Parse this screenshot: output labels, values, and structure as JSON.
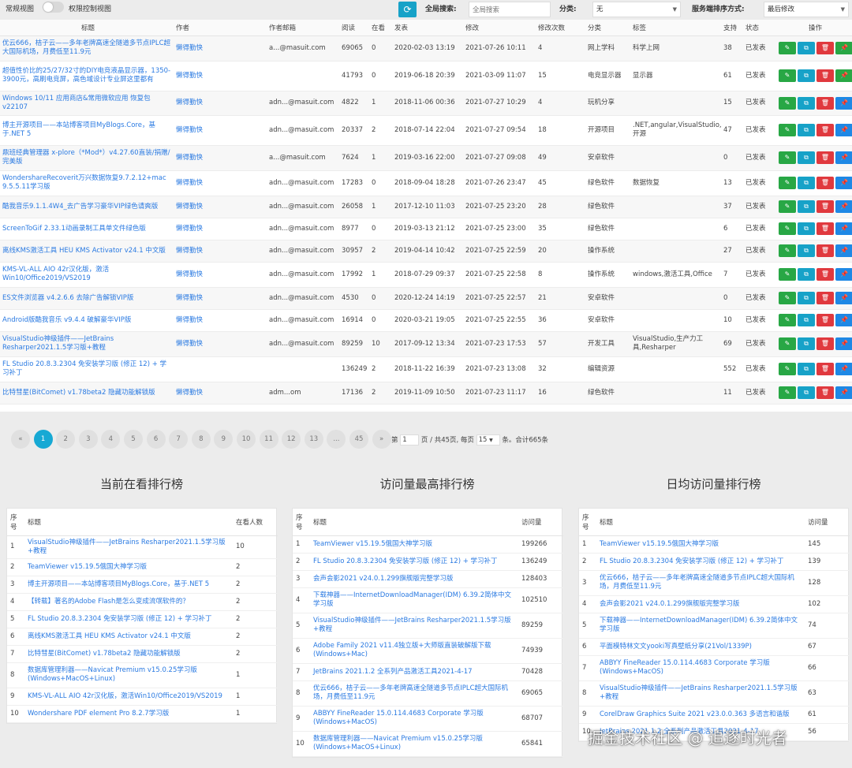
{
  "topbar": {
    "view_label": "常规视图",
    "perm_label": "权限控制视图",
    "search_label": "全局搜索:",
    "search_placeholder": "全局搜索",
    "category_label": "分类:",
    "category_value": "无",
    "sort_label": "服务端排序方式:",
    "sort_value": "最后修改"
  },
  "table": {
    "headers": [
      "标题",
      "作者",
      "作者邮箱",
      "阅读",
      "在看",
      "发表",
      "修改",
      "修改次数",
      "分类",
      "标签",
      "支持",
      "状态",
      "操作"
    ],
    "rows": [
      {
        "title": "优云666，桔子云——多年老牌高速全隧道多节点IPLC超大国际机场，月费低至11.9元",
        "author": "懒得勤快",
        "email": "a...@masuit.com",
        "read": "69065",
        "watch": "0",
        "created": "2020-02-03 13:19",
        "modified": "2021-07-26 10:11",
        "mods": "4",
        "cat": "网上学科",
        "tags": "科学上网",
        "support": "38",
        "status": "已发表"
      },
      {
        "title": "超值性价比的25/27/32寸的DIY电竞液晶显示器，1350-3900元，高刷电竞屏，高色域设计专业屏这里都有",
        "author": "懒得勤快",
        "email": "",
        "read": "41793",
        "watch": "0",
        "created": "2019-06-18 20:39",
        "modified": "2021-03-09 11:07",
        "mods": "15",
        "cat": "电竞显示器",
        "tags": "显示器",
        "support": "61",
        "status": "已发表"
      },
      {
        "title": "Windows 10/11 应用商店&常用微软应用 恢复包v22107",
        "author": "懒得勤快",
        "email": "adn...@masuit.com",
        "read": "4822",
        "watch": "1",
        "created": "2018-11-06 00:36",
        "modified": "2021-07-27 10:29",
        "mods": "4",
        "cat": "玩机分享",
        "tags": "",
        "support": "15",
        "status": "已发表"
      },
      {
        "title": "博主开源项目——本站博客项目MyBlogs.Core，基于.NET 5",
        "author": "懒得勤快",
        "email": "adn...@masuit.com",
        "read": "20337",
        "watch": "2",
        "created": "2018-07-14 22:04",
        "modified": "2021-07-27 09:54",
        "mods": "18",
        "cat": "开源项目",
        "tags": ".NET,angular,VisualStudio,开源",
        "support": "47",
        "status": "已发表"
      },
      {
        "title": "鼎班经典管理器 x-plore（*Mod*）v4.27.60直装/捐赠/完美版",
        "author": "懒得勤快",
        "email": "a...@masuit.com",
        "read": "7624",
        "watch": "1",
        "created": "2019-03-16 22:00",
        "modified": "2021-07-27 09:08",
        "mods": "49",
        "cat": "安卓软件",
        "tags": "",
        "support": "0",
        "status": "已发表"
      },
      {
        "title": "WondershareRecoverit万兴数据恢复9.7.2.12+mac 9.5.5.11学习版",
        "author": "懒得勤快",
        "email": "adn...@masuit.com",
        "read": "17283",
        "watch": "0",
        "created": "2018-09-04 18:28",
        "modified": "2021-07-26 23:47",
        "mods": "45",
        "cat": "绿色软件",
        "tags": "数据恢复",
        "support": "13",
        "status": "已发表"
      },
      {
        "title": "酷我音乐9.1.1.4W4_去广告学习豪华VIP绿色请爽版",
        "author": "懒得勤快",
        "email": "adn...@masuit.com",
        "read": "26058",
        "watch": "1",
        "created": "2017-12-10 11:03",
        "modified": "2021-07-25 23:20",
        "mods": "28",
        "cat": "绿色软件",
        "tags": "",
        "support": "37",
        "status": "已发表"
      },
      {
        "title": "ScreenToGif 2.33.1动画录制工具单文件绿色版",
        "author": "懒得勤快",
        "email": "adn...@masuit.com",
        "read": "8977",
        "watch": "0",
        "created": "2019-03-13 21:12",
        "modified": "2021-07-25 23:00",
        "mods": "35",
        "cat": "绿色软件",
        "tags": "",
        "support": "6",
        "status": "已发表"
      },
      {
        "title": "离线KMS激活工具 HEU KMS Activator v24.1 中文版",
        "author": "懒得勤快",
        "email": "adn...@masuit.com",
        "read": "30957",
        "watch": "2",
        "created": "2019-04-14 10:42",
        "modified": "2021-07-25 22:59",
        "mods": "20",
        "cat": "操作系统",
        "tags": "",
        "support": "27",
        "status": "已发表"
      },
      {
        "title": "KMS-VL-ALL AIO 42r汉化版，激活Win10/Office2019/VS2019",
        "author": "懒得勤快",
        "email": "adn...@masuit.com",
        "read": "17992",
        "watch": "1",
        "created": "2018-07-29 09:37",
        "modified": "2021-07-25 22:58",
        "mods": "8",
        "cat": "操作系统",
        "tags": "windows,激活工具,Office",
        "support": "7",
        "status": "已发表"
      },
      {
        "title": "ES文件浏览器 v4.2.6.6 去除广告解锁VIP版",
        "author": "懒得勤快",
        "email": "adn...@masuit.com",
        "read": "4530",
        "watch": "0",
        "created": "2020-12-24 14:19",
        "modified": "2021-07-25 22:57",
        "mods": "21",
        "cat": "安卓软件",
        "tags": "",
        "support": "0",
        "status": "已发表"
      },
      {
        "title": "Android版酷我音乐 v9.4.4 破解豪华VIP版",
        "author": "懒得勤快",
        "email": "adn...@masuit.com",
        "read": "16914",
        "watch": "0",
        "created": "2020-03-21 19:05",
        "modified": "2021-07-25 22:55",
        "mods": "36",
        "cat": "安卓软件",
        "tags": "",
        "support": "10",
        "status": "已发表"
      },
      {
        "title": "VisualStudio神级插件——JetBrains Resharper2021.1.5学习版+教程",
        "author": "懒得勤快",
        "email": "adn...@masuit.com",
        "read": "89259",
        "watch": "10",
        "created": "2017-09-12 13:34",
        "modified": "2021-07-23 17:53",
        "mods": "57",
        "cat": "开发工具",
        "tags": "VisualStudio,生产力工具,Resharper",
        "support": "69",
        "status": "已发表"
      },
      {
        "title": "FL Studio 20.8.3.2304 免安装学习版 (修正 12) + 学习补丁",
        "author": "",
        "email": "",
        "read": "136249",
        "watch": "2",
        "created": "2018-11-22 16:39",
        "modified": "2021-07-23 13:08",
        "mods": "32",
        "cat": "编辑资源",
        "tags": "",
        "support": "552",
        "status": "已发表"
      },
      {
        "title": "比特彗星(BitComet) v1.78beta2 隐藏功能解锁版",
        "author": "懒得勤快",
        "email": "adm...om",
        "read": "17136",
        "watch": "2",
        "created": "2019-11-09 10:50",
        "modified": "2021-07-23 11:17",
        "mods": "16",
        "cat": "绿色软件",
        "tags": "",
        "support": "11",
        "status": "已发表"
      }
    ]
  },
  "pager": {
    "pages": [
      "«",
      "1",
      "2",
      "3",
      "4",
      "5",
      "6",
      "7",
      "8",
      "9",
      "10",
      "11",
      "12",
      "13",
      "...",
      "45",
      "»"
    ],
    "info_prefix": "第",
    "page_value": "1",
    "info_mid": "页 / 共45页, 每页",
    "per_page": "15",
    "info_suffix": "条。合计665条"
  },
  "panels": [
    {
      "title": "当前在看排行榜",
      "headers": [
        "序号",
        "标题",
        "在看人数"
      ],
      "rows": [
        [
          "1",
          "VisualStudio神级插件——JetBrains Resharper2021.1.5学习版+教程",
          "10"
        ],
        [
          "2",
          "TeamViewer v15.19.5俄国大神学习版",
          "2"
        ],
        [
          "3",
          "博主开源项目——本站博客项目MyBlogs.Core，基于.NET 5",
          "2"
        ],
        [
          "4",
          "【转载】著名的Adobe Flash是怎么变成流氓软件的？",
          "2"
        ],
        [
          "5",
          "FL Studio 20.8.3.2304 免安装学习版 (修正 12) + 学习补丁",
          "2"
        ],
        [
          "6",
          "离线KMS激活工具 HEU KMS Activator v24.1 中文版",
          "2"
        ],
        [
          "7",
          "比特彗星(BitComet) v1.78beta2 隐藏功能解锁版",
          "2"
        ],
        [
          "8",
          "数据库管理利器——Navicat Premium v15.0.25学习版(Windows+MacOS+Linux)",
          "1"
        ],
        [
          "9",
          "KMS-VL-ALL AIO 42r汉化版，激活Win10/Office2019/VS2019",
          "1"
        ],
        [
          "10",
          "Wondershare PDF element Pro 8.2.7学习版",
          "1"
        ]
      ]
    },
    {
      "title": "访问量最高排行榜",
      "headers": [
        "序号",
        "标题",
        "访问量"
      ],
      "rows": [
        [
          "1",
          "TeamViewer v15.19.5俄国大神学习版",
          "199266"
        ],
        [
          "2",
          "FL Studio 20.8.3.2304 免安装学习版 (修正 12) + 学习补丁",
          "136249"
        ],
        [
          "3",
          "会声会影2021 v24.0.1.299旗舰版完整学习版",
          "128403"
        ],
        [
          "4",
          "下载神器——InternetDownloadManager(IDM) 6.39.2简体中文学习版",
          "102510"
        ],
        [
          "5",
          "VisualStudio神级插件——JetBrains Resharper2021.1.5学习版+教程",
          "89259"
        ],
        [
          "6",
          "Adobe Family 2021 v11.4独立版+大师版直装破解版下载(Windows+Mac)",
          "74939"
        ],
        [
          "7",
          "JetBrains 2021.1.2 全系列产品激活工具2021-4-17",
          "70428"
        ],
        [
          "8",
          "优云666，桔子云——多年老牌高速全隧道多节点IPLC超大国际机场，月费低至11.9元",
          "69065"
        ],
        [
          "9",
          "ABBYY FineReader 15.0.114.4683 Corporate 学习版(Windows+MacOS)",
          "68707"
        ],
        [
          "10",
          "数据库管理利器——Navicat Premium v15.0.25学习版(Windows+MacOS+Linux)",
          "65841"
        ]
      ]
    },
    {
      "title": "日均访问量排行榜",
      "headers": [
        "序号",
        "标题",
        "访问量"
      ],
      "rows": [
        [
          "1",
          "TeamViewer v15.19.5俄国大神学习版",
          "145"
        ],
        [
          "2",
          "FL Studio 20.8.3.2304 免安装学习版 (修正 12) + 学习补丁",
          "139"
        ],
        [
          "3",
          "优云666，桔子云——多年老牌高速全隧道多节点IPLC超大国际机场，月费低至11.9元",
          "128"
        ],
        [
          "4",
          "会声会影2021 v24.0.1.299旗舰版完整学习版",
          "102"
        ],
        [
          "5",
          "下载神器——InternetDownloadManager(IDM) 6.39.2简体中文学习版",
          "74"
        ],
        [
          "6",
          "平面模特林文文yooki写真壁纸分享(21Vol/1339P)",
          "67"
        ],
        [
          "7",
          "ABBYY FineReader 15.0.114.4683 Corporate 学习版(Windows+MacOS)",
          "66"
        ],
        [
          "8",
          "VisualStudio神级插件——JetBrains Resharper2021.1.5学习版+教程",
          "63"
        ],
        [
          "9",
          "CorelDraw Graphics Suite 2021 v23.0.0.363 多语言和谐版",
          "61"
        ],
        [
          "10",
          "JetBrains 2021.1.2 全系列产品激活工具2021-4-17",
          "56"
        ]
      ]
    }
  ],
  "watermark": "掘金技术社区 @ 追逐时光者",
  "colors": {
    "accent": "#17a9d4",
    "edit": "#28a745",
    "copy": "#17a2c8",
    "delete": "#e0393e",
    "pin": "#1e88e5",
    "link": "#2a7ae2"
  }
}
